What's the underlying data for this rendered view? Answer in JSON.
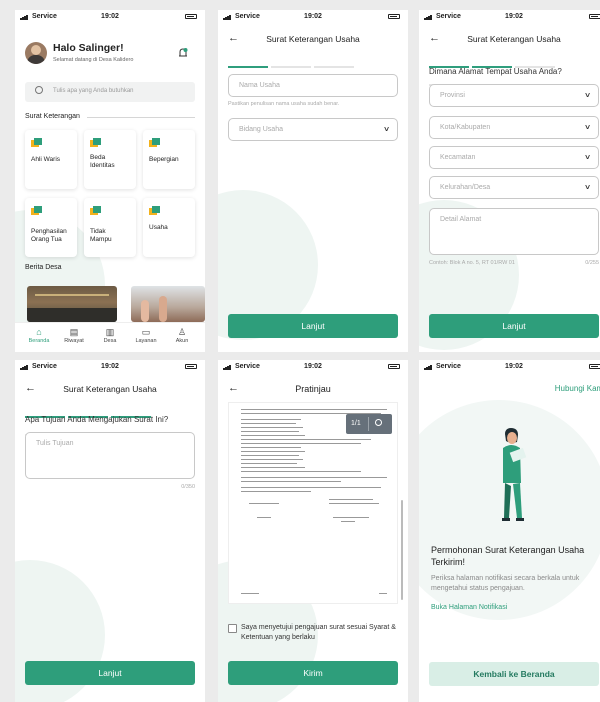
{
  "status": {
    "carrier": "Service",
    "time": "19:02"
  },
  "home": {
    "greeting": "Halo Salinger!",
    "subtitle": "Selamat datang di Desa Kalidero",
    "search_placeholder": "Tulis apa yang Anda butuhkan",
    "section_title": "Surat Keterangan",
    "cards": [
      "Ahli Waris",
      "Beda Identitas",
      "Bepergian",
      "Penghasilan Orang Tua",
      "Tidak Mampu",
      "Usaha"
    ],
    "news_title": "Berita Desa",
    "nav": [
      "Beranda",
      "Riwayat",
      "Desa",
      "Layanan",
      "Akun"
    ]
  },
  "form_title": "Surat Keterangan Usaha",
  "step1": {
    "name_placeholder": "Nama Usaha",
    "name_hint": "Pastikan penulisan nama usaha sudah benar.",
    "field_placeholder": "Bidang Usaha",
    "button": "Lanjut"
  },
  "step2": {
    "question": "Dimana Alamat Tempat Usaha Anda?",
    "selects": [
      "Provinsi",
      "Kota/Kabupaten",
      "Kecamatan",
      "Kelurahan/Desa"
    ],
    "address_placeholder": "Detail Alamat",
    "address_hint": "Contoh: Blok A no. 5, RT 01/RW 01",
    "address_count": "0/255",
    "button": "Lanjut"
  },
  "step3": {
    "question": "Apa Tujuan Anda Mengajukan Surat Ini?",
    "placeholder": "Tulis Tujuan",
    "count": "0/350",
    "button": "Lanjut"
  },
  "preview": {
    "title": "Pratinjau",
    "page_counter": "1/1",
    "agree_text": "Saya menyetujui pengajuan surat sesuai Syarat & Ketentuan yang berlaku",
    "button": "Kirim"
  },
  "success": {
    "help_link": "Hubungi Kami",
    "title": "Permohonan Surat Keterangan Usaha Terkirim!",
    "body": "Periksa halaman notifikasi secara berkala untuk mengetahui status pengajuan.",
    "notif_link": "Buka Halaman Notifikasi",
    "button": "Kembali ke Beranda"
  },
  "colors": {
    "primary": "#2e9e7b",
    "primary_light": "#d9eee6",
    "accent_icon": "#f2b21c"
  }
}
